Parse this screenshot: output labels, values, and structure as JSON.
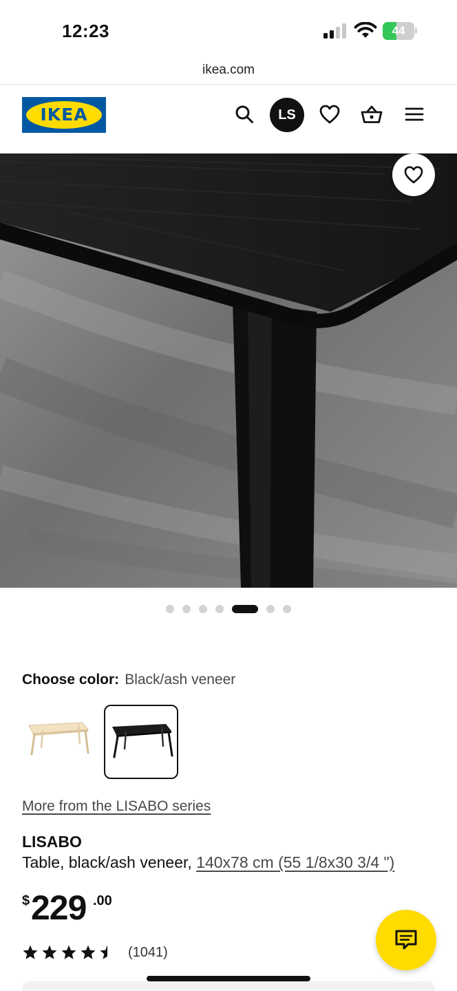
{
  "status_bar": {
    "time": "12:23",
    "battery_level": "44",
    "battery_fraction": 0.44
  },
  "browser": {
    "url": "ikea.com"
  },
  "header": {
    "logo_text": "IKEA",
    "avatar_initials": "LS",
    "icons": [
      "search-icon",
      "heart-icon",
      "basket-icon",
      "menu-icon"
    ]
  },
  "carousel": {
    "slide_count": 7,
    "active_index": 4
  },
  "color_chooser": {
    "label": "Choose color:",
    "selected_value": "Black/ash veneer",
    "swatches": [
      "natural-table",
      "black-table"
    ],
    "selected_index": 1
  },
  "product": {
    "series_link": "More from the LISABO series",
    "name": "LISABO",
    "description": "Table, black/ash veneer,",
    "dimensions": "140x78 cm (55 1/8x30 3/4 \")",
    "price": {
      "currency": "$",
      "integer": "229",
      "decimals": ".00"
    },
    "rating": {
      "value": 4.5,
      "max": 5,
      "count": "(1041)"
    }
  },
  "colors": {
    "ikea_blue": "#0058a3",
    "ikea_yellow": "#ffdb00",
    "battery_green": "#34c759"
  }
}
